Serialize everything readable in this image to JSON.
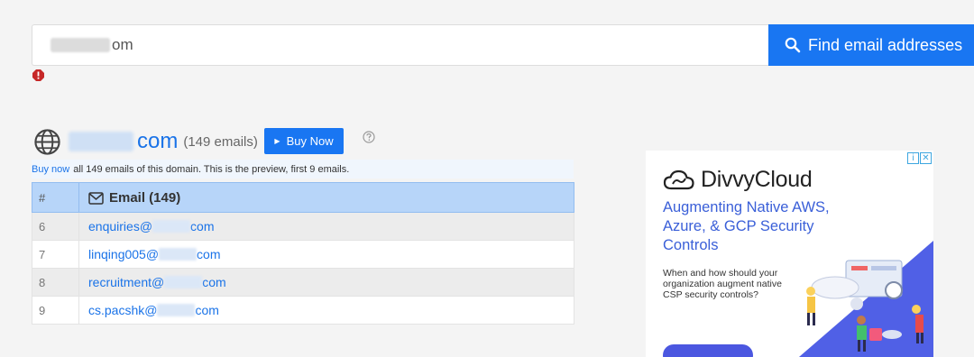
{
  "search": {
    "value_suffix": "om",
    "button_label": "Find email addresses"
  },
  "domain": {
    "tld": "com",
    "count_label": "(149 emails)",
    "buy_label": "Buy Now"
  },
  "preview": {
    "link": "Buy now",
    "text": "all 149 emails of this domain. This is the preview, first 9 emails."
  },
  "table": {
    "num_header": "#",
    "email_header": "Email (149)",
    "rows": [
      {
        "num": "6",
        "local": "enquiries@",
        "tld": "com"
      },
      {
        "num": "7",
        "local": "linqing005@",
        "tld": "com"
      },
      {
        "num": "8",
        "local": "recruitment@",
        "tld": "com"
      },
      {
        "num": "9",
        "local": "cs.pacshk@",
        "tld": "com"
      }
    ]
  },
  "ad": {
    "brand": "DivvyCloud",
    "headline": "Augmenting Native AWS, Azure, & GCP Security Controls",
    "body": "When and how should your organization augment native CSP security controls?",
    "accent": "#3a5fd8"
  },
  "colors": {
    "primary": "#1976f2",
    "link": "#1a73e8",
    "error": "#c62828"
  }
}
